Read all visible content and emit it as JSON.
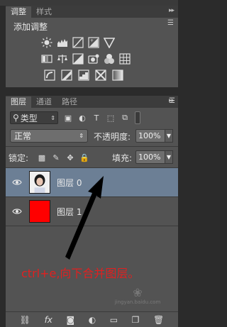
{
  "adjustments": {
    "tabs": [
      "调整",
      "样式"
    ],
    "title": "添加调整"
  },
  "layers_panel": {
    "tabs": [
      "图层",
      "通道",
      "路径"
    ],
    "filter_label": "类型",
    "blend_mode": "正常",
    "opacity_label": "不透明度:",
    "opacity_value": "100%",
    "lock_label": "锁定:",
    "fill_label": "填充:",
    "fill_value": "100%",
    "layers": [
      {
        "name": "图层 0",
        "thumbnail": "portrait-photo",
        "selected": true
      },
      {
        "name": "图层 1",
        "thumbnail": "solid-red",
        "selected": false
      }
    ]
  },
  "annotation": {
    "text": "ctrl+e,向下合并图层。",
    "color": "#e02020"
  },
  "footer_icons": [
    "link-icon",
    "fx-icon",
    "mask-icon",
    "adjustment-icon",
    "folder-icon",
    "new-layer-icon",
    "trash-icon"
  ],
  "watermark": {
    "url": "jingyan.baidu.com"
  },
  "colors": {
    "panel_bg": "#535353",
    "selected_row": "#6c7f95",
    "red_layer": "#ff0000",
    "annotation": "#e02020"
  }
}
